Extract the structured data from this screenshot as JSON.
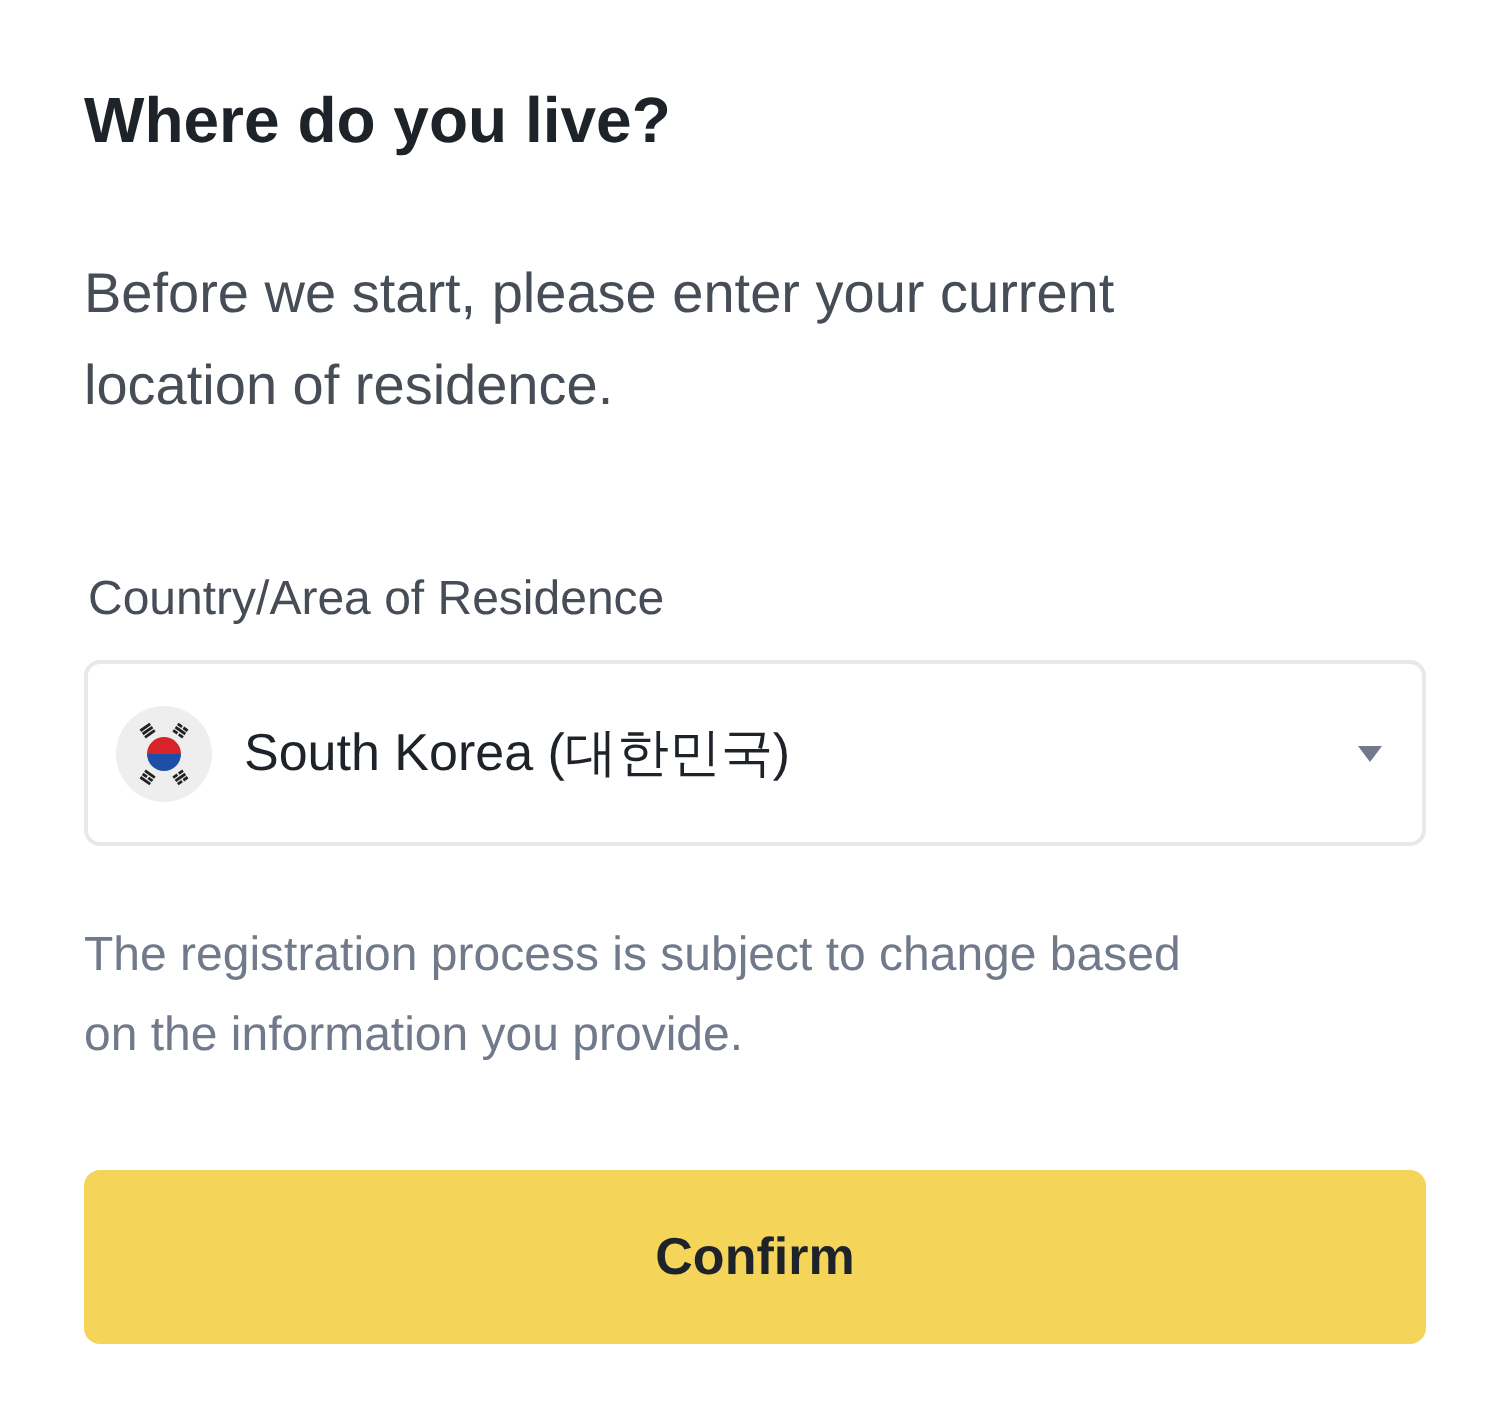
{
  "heading": "Where do you live?",
  "intro": "Before we start, please enter your current location of residence.",
  "country_field": {
    "label": "Country/Area of Residence",
    "value": "South Korea (대한민국)"
  },
  "note": "The registration process is subject to change based on the information you provide.",
  "confirm_button": {
    "label": "Confirm"
  }
}
